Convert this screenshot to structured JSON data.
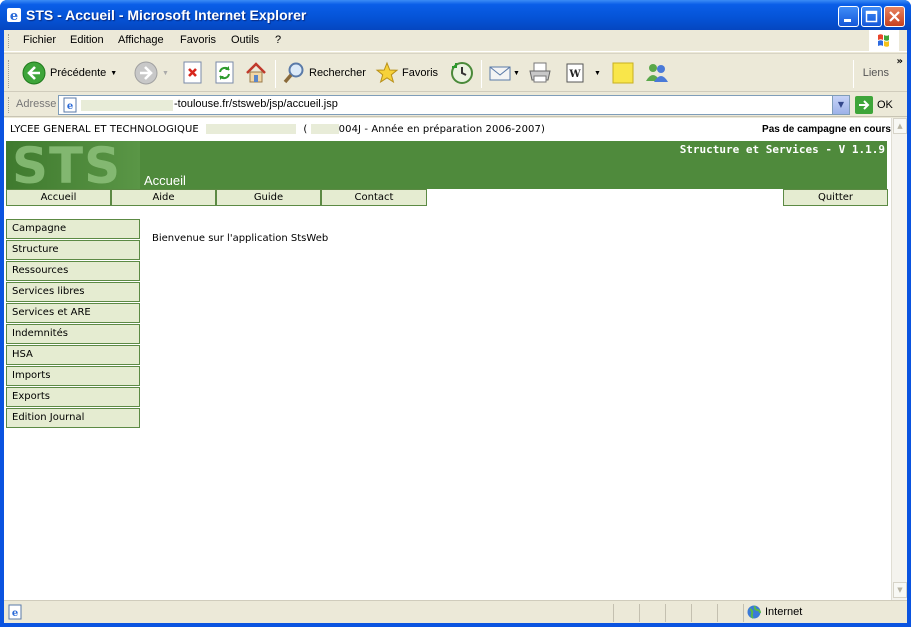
{
  "window": {
    "title": "STS - Accueil - Microsoft Internet Explorer"
  },
  "menubar": {
    "items": [
      "Fichier",
      "Edition",
      "Affichage",
      "Favoris",
      "Outils",
      "?"
    ]
  },
  "toolbar": {
    "back_label": "Précédente",
    "search_label": "Rechercher",
    "favorites_label": "Favoris",
    "links_label": "Liens"
  },
  "addressbar": {
    "label": "Adresse",
    "url_visible": "-toulouse.fr/stsweb/jsp/accueil.jsp",
    "go_label": "OK"
  },
  "page": {
    "school_name": "LYCEE GENERAL ET TECHNOLOGIQUE",
    "school_code_suffix": "004J - Année en préparation 2006-2007)",
    "open_paren": "(",
    "campaign_status": "Pas de campagne en cours",
    "banner_logo": "STS",
    "banner_version": "Structure et Services - V 1.1.9",
    "section_title": "Accueil",
    "topnav": [
      "Accueil",
      "Aide",
      "Guide",
      "Contact"
    ],
    "quit_label": "Quitter",
    "sidenav": [
      "Campagne",
      "Structure",
      "Ressources",
      "Services libres",
      "Services et ARE",
      "Indemnités",
      "HSA",
      "Imports",
      "Exports",
      "Edition Journal"
    ],
    "welcome_text": "Bienvenue sur l'application StsWeb"
  },
  "statusbar": {
    "zone": "Internet"
  },
  "colors": {
    "banner_green": "#4f8a3c",
    "nav_fill": "#e5ecd1",
    "nav_border": "#5c8a44",
    "xp_blue": "#0553d6"
  }
}
